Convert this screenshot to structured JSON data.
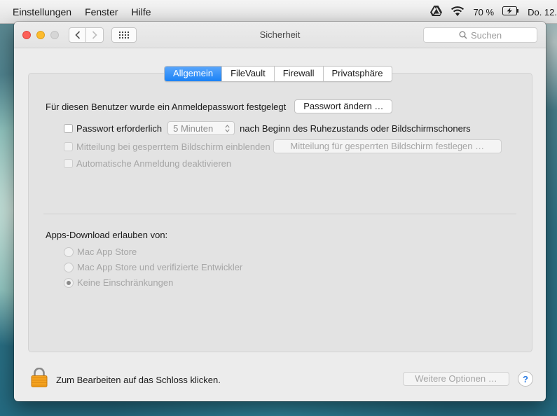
{
  "menubar": {
    "items": [
      "Einstellungen",
      "Fenster",
      "Hilfe"
    ],
    "battery_text": "70 %",
    "clock_text": "Do. 12."
  },
  "window": {
    "title": "Sicherheit",
    "search_placeholder": "Suchen",
    "tabs": [
      "Allgemein",
      "FileVault",
      "Firewall",
      "Privatsphäre"
    ],
    "active_tab": "Allgemein"
  },
  "general": {
    "password_set_text": "Für diesen Benutzer wurde ein Anmeldepasswort festgelegt",
    "change_password_button": "Passwort ändern …",
    "require_password_label": "Passwort erforderlich",
    "require_password_delay": "5 Minuten",
    "require_password_suffix": "nach Beginn des Ruhezustands oder Bildschirmschoners",
    "show_message_label": "Mitteilung bei gesperrtem Bildschirm einblenden",
    "set_message_button": "Mitteilung für gesperrten Bildschirm festlegen …",
    "disable_autologin_label": "Automatische Anmeldung deaktivieren"
  },
  "downloads": {
    "heading": "Apps-Download erlauben von:",
    "options": [
      "Mac App Store",
      "Mac App Store und verifizierte Entwickler",
      "Keine Einschränkungen"
    ],
    "selected": "Keine Einschränkungen"
  },
  "footer": {
    "lock_text": "Zum Bearbeiten auf das Schloss klicken.",
    "advanced_button": "Weitere Optionen …",
    "help_label": "?"
  },
  "icons": [
    "google-drive-icon",
    "wifi-icon",
    "battery-charging-icon",
    "chevron-left-icon",
    "chevron-right-icon",
    "grid-icon",
    "search-icon",
    "lock-icon",
    "stepper-icon"
  ],
  "colors": {
    "accent": "#1a82f6",
    "close": "#fc5f57",
    "minimize": "#fdbc2e",
    "lock": "#f4a21f"
  }
}
